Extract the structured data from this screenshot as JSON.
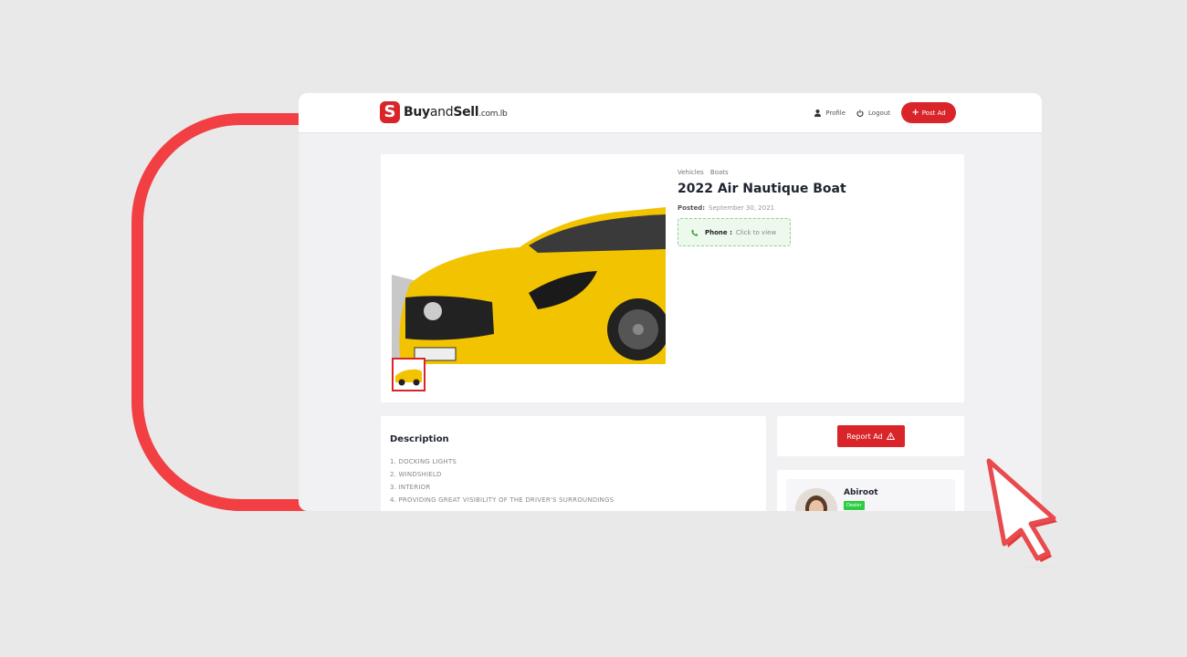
{
  "header": {
    "logo": {
      "letter": "S",
      "buy": "Buy",
      "and": "and",
      "sell": "Sell",
      "domain": ".com.lb"
    },
    "nav": {
      "profile": "Profile",
      "logout": "Logout",
      "post_ad": "Post Ad"
    }
  },
  "listing": {
    "breadcrumbs": [
      "Vehicles",
      "Boats"
    ],
    "title": "2022 Air Nautique Boat",
    "posted_label": "Posted:",
    "posted_date": "September 30, 2021",
    "phone_label": "Phone :",
    "phone_value": "Click to view"
  },
  "description": {
    "heading": "Description",
    "items": [
      "1. DOCKING LIGHTS",
      "2. WINDSHIELD",
      "3. INTERIOR",
      "4. PROVIDING GREAT VISIBILITY OF THE DRIVER'S SURROUNDINGS"
    ]
  },
  "report": {
    "label": "Report Ad"
  },
  "seller": {
    "name": "Abiroot",
    "badge": "Dealer"
  },
  "colors": {
    "brand": "#d9252a",
    "deco": "#f23f43",
    "dealer_badge": "#2ecc40"
  }
}
